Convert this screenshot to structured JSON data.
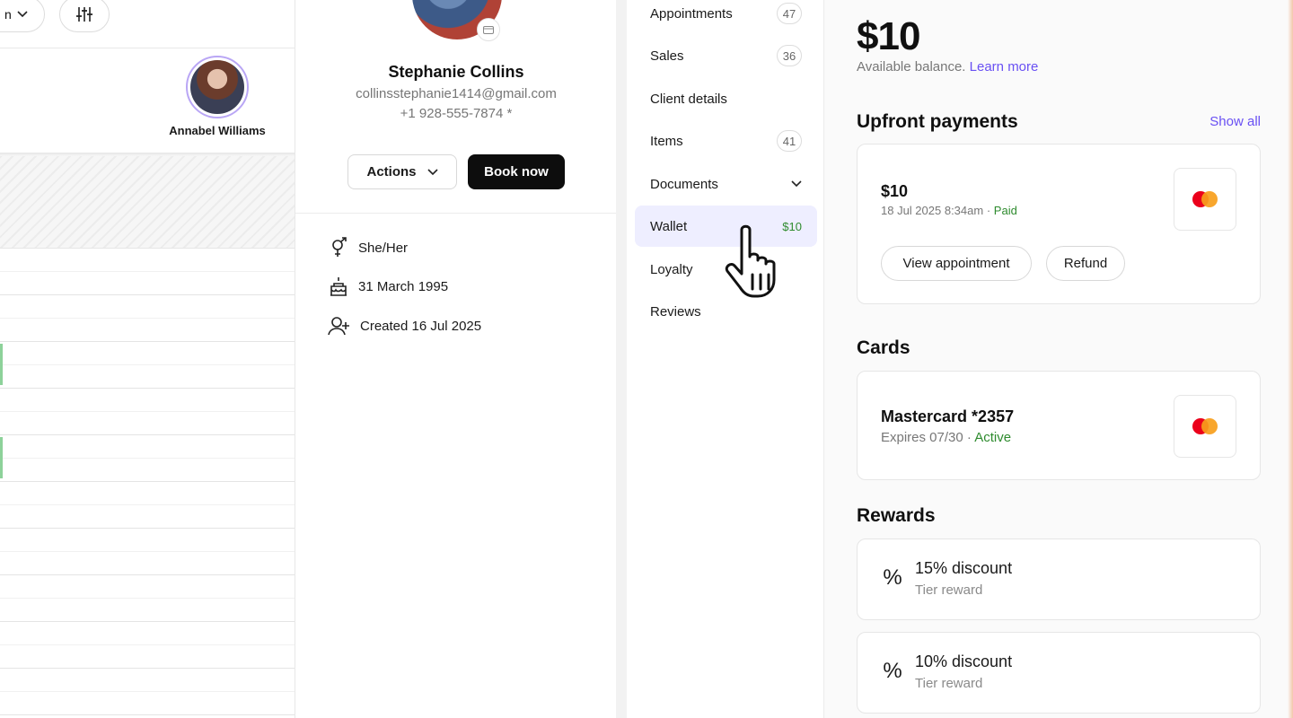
{
  "calendar": {
    "staff_name": "Annabel Williams"
  },
  "client": {
    "name": "Stephanie Collins",
    "email": "collinsstephanie1414@gmail.com",
    "phone": "+1 928-555-7874 *",
    "actions_label": "Actions",
    "book_label": "Book now",
    "pronouns": "She/Her",
    "birthday": "31 March 1995",
    "created": "Created 16 Jul 2025"
  },
  "nav": {
    "items": [
      {
        "label": "Appointments",
        "count": "47"
      },
      {
        "label": "Sales",
        "count": "36"
      },
      {
        "label": "Client details"
      },
      {
        "label": "Items",
        "count": "41"
      },
      {
        "label": "Documents"
      },
      {
        "label": "Wallet",
        "value": "$10"
      },
      {
        "label": "Loyalty"
      },
      {
        "label": "Reviews"
      }
    ]
  },
  "wallet": {
    "balance": "$10",
    "balance_label": "Available balance.",
    "learn_more": "Learn more",
    "upfront_title": "Upfront payments",
    "show_all": "Show all",
    "payment": {
      "amount": "$10",
      "date": "18 Jul 2025 8:34am",
      "separator": "·",
      "status": "Paid",
      "view_label": "View appointment",
      "refund_label": "Refund"
    },
    "cards_title": "Cards",
    "card": {
      "name": "Mastercard *2357",
      "expires": "Expires 07/30 ·",
      "status": "Active"
    },
    "rewards_title": "Rewards",
    "rewards": [
      {
        "title": "15% discount",
        "subtitle": "Tier reward",
        "icon": "%"
      },
      {
        "title": "10% discount",
        "subtitle": "Tier reward",
        "icon": "%"
      }
    ]
  }
}
